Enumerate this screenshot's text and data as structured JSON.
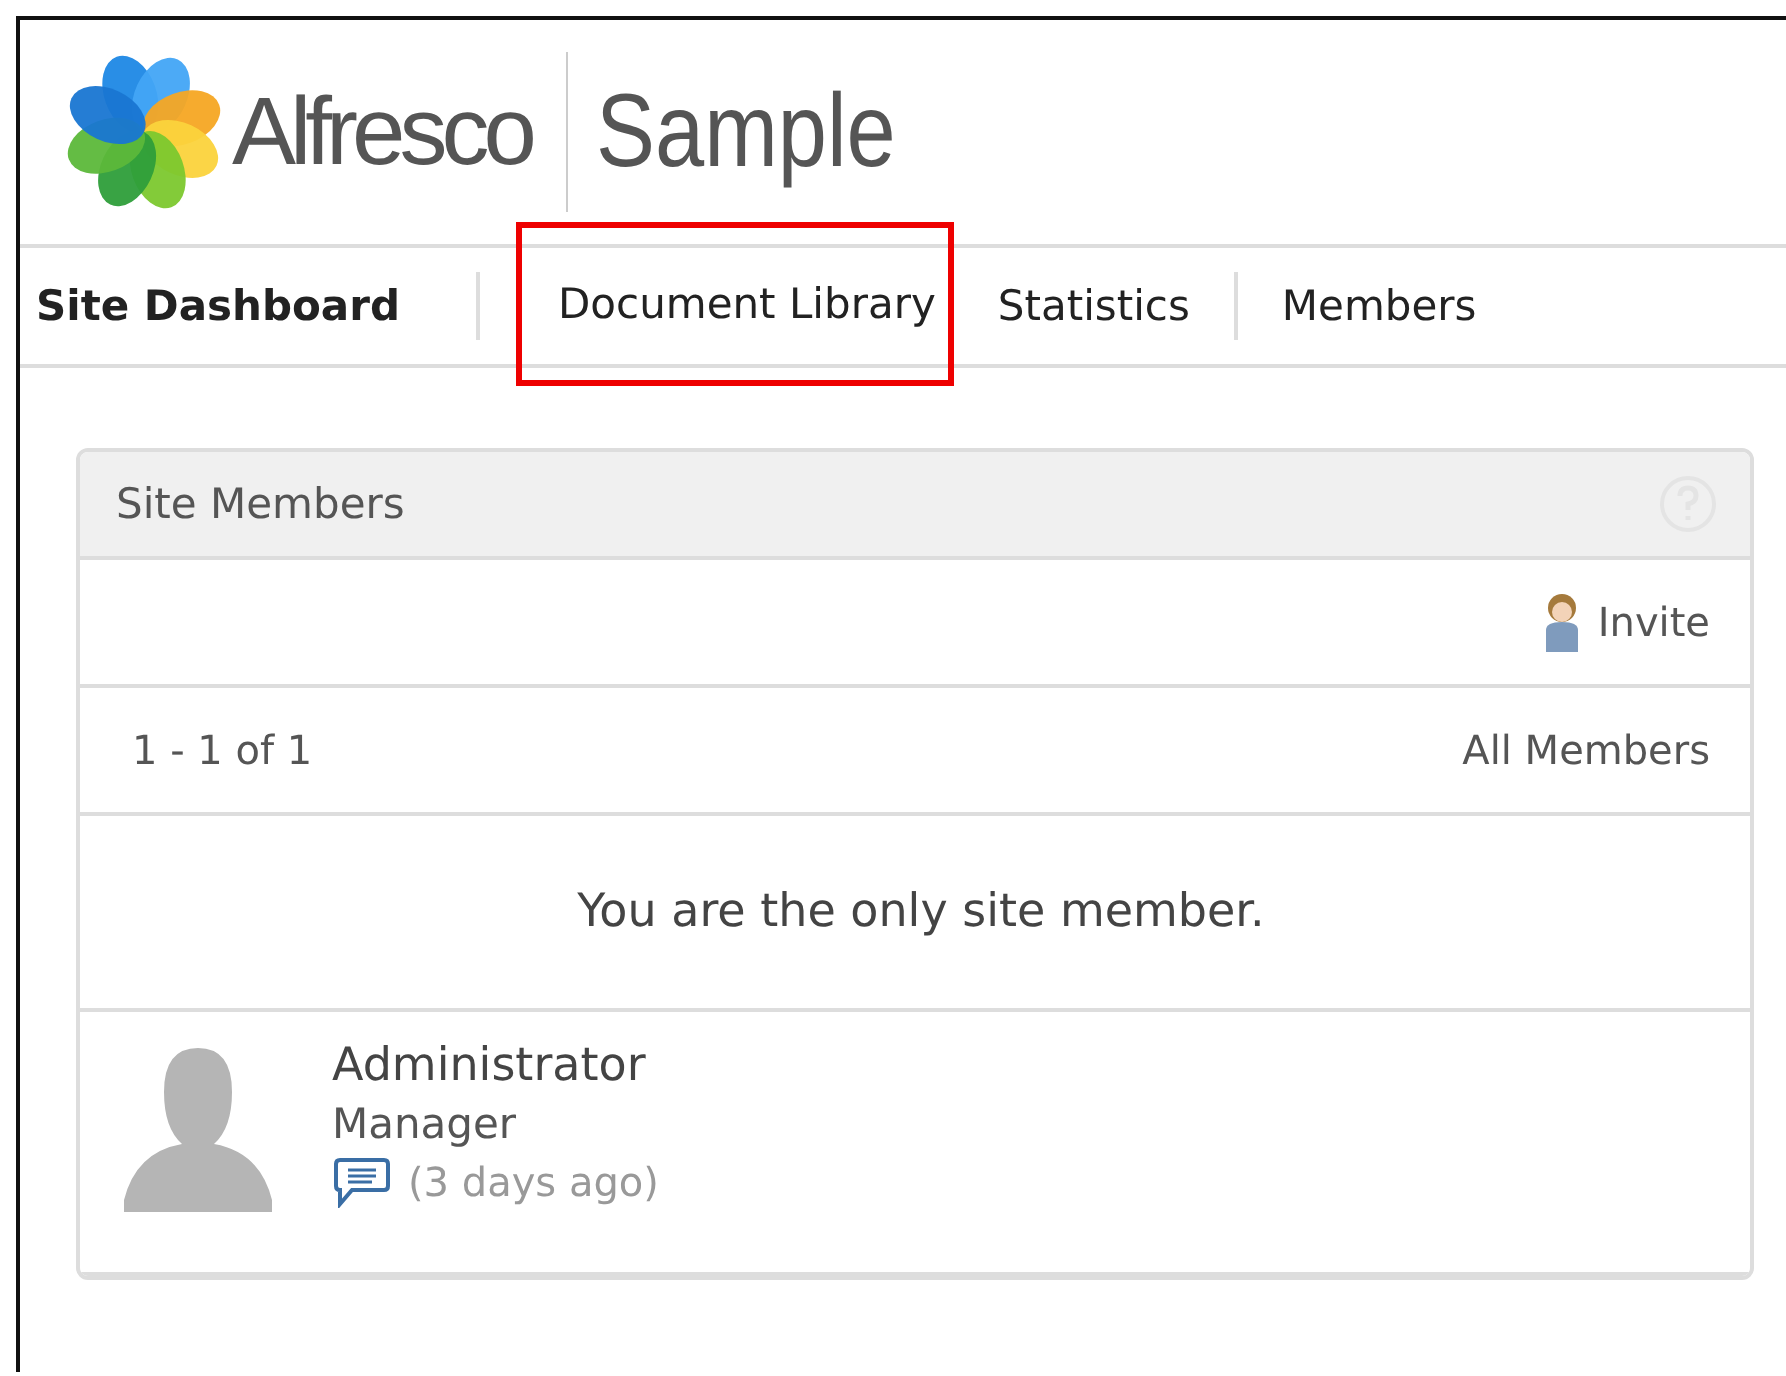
{
  "header": {
    "logo_text": "Alfresco",
    "site_title": "Sample"
  },
  "nav": [
    {
      "label": "Site Dashboard",
      "selected": true,
      "highlighted": false,
      "separator_before": false
    },
    {
      "label": "Document Library",
      "selected": false,
      "highlighted": true,
      "separator_before": true
    },
    {
      "label": "Statistics",
      "selected": false,
      "highlighted": false,
      "separator_before": false
    },
    {
      "label": "Members",
      "selected": false,
      "highlighted": false,
      "separator_before": true
    }
  ],
  "dashlet": {
    "title": "Site Members",
    "invite": "Invite",
    "paging": "1 - 1 of 1",
    "all_members": "All Members",
    "message": "You are the only site member.",
    "members": [
      {
        "name": "Administrator",
        "role": "Manager",
        "activity": "(3 days ago)"
      }
    ]
  }
}
